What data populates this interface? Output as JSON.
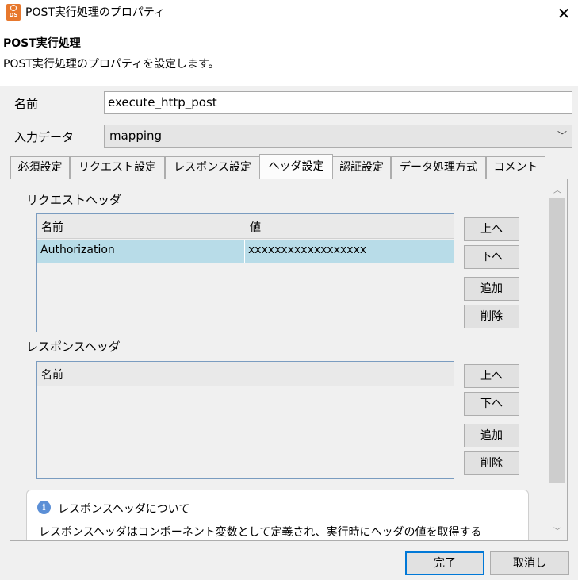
{
  "window": {
    "title": "POST実行処理のプロパティ",
    "app_icon_text": "DS"
  },
  "header": {
    "title": "POST実行処理",
    "description": "POST実行処理のプロパティを設定します。"
  },
  "form": {
    "name_label": "名前",
    "name_value": "execute_http_post",
    "input_label": "入力データ",
    "input_value": "mapping"
  },
  "tabs": [
    {
      "label": "必須設定"
    },
    {
      "label": "リクエスト設定"
    },
    {
      "label": "レスポンス設定"
    },
    {
      "label": "ヘッダ設定",
      "active": true
    },
    {
      "label": "認証設定"
    },
    {
      "label": "データ処理方式"
    },
    {
      "label": "コメント"
    }
  ],
  "request_headers": {
    "title": "リクエストヘッダ",
    "columns": [
      "名前",
      "値"
    ],
    "rows": [
      {
        "name": "Authorization",
        "value": "xxxxxxxxxxxxxxxxxx"
      }
    ],
    "buttons": {
      "up": "上へ",
      "down": "下へ",
      "add": "追加",
      "delete": "削除"
    }
  },
  "response_headers": {
    "title": "レスポンスヘッダ",
    "columns": [
      "名前"
    ],
    "rows": [],
    "buttons": {
      "up": "上へ",
      "down": "下へ",
      "add": "追加",
      "delete": "削除"
    }
  },
  "info": {
    "title": "レスポンスヘッダについて",
    "text": "レスポンスヘッダはコンポーネント変数として定義され、実行時にヘッダの値を取得する"
  },
  "footer": {
    "finish": "完了",
    "cancel": "取消し"
  },
  "colors": {
    "selected_row": "#b8dce8",
    "table_border": "#7a9cc0",
    "app_icon": "#e7782d"
  }
}
